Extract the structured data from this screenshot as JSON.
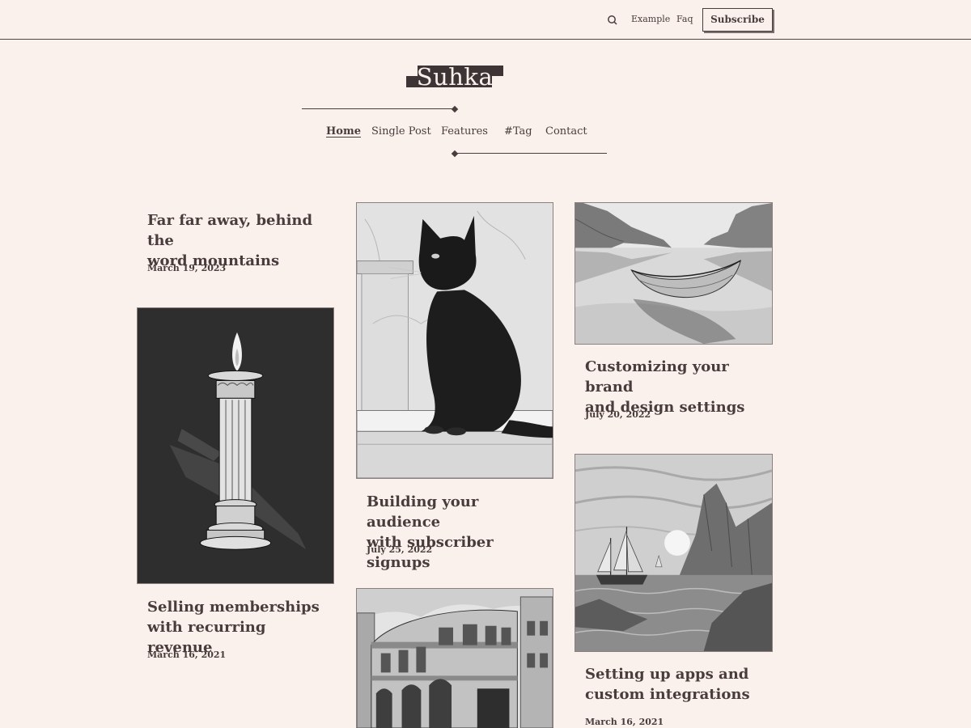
{
  "header": {
    "search_icon": "search-icon",
    "links": [
      "Example",
      "Faq"
    ],
    "subscribe_label": "Subscribe"
  },
  "site": {
    "logo_text": "Suhka"
  },
  "nav": {
    "items": [
      "Home",
      "Single Post",
      "Features",
      "#Tag",
      "Contact"
    ],
    "active": "Home"
  },
  "posts": [
    {
      "title_line1": "Far far away, behind the",
      "title_line2": "word mountains",
      "date": "March 19, 2023"
    },
    {
      "title_line1": "Selling memberships",
      "title_line2": "with recurring revenue",
      "date": "March 16, 2021"
    },
    {
      "title_line1": "Building your audience",
      "title_line2": "with subscriber signups",
      "date": "July 25, 2022"
    },
    {
      "title_line1": "Customizing your brand",
      "title_line2": "and design settings",
      "date": "July 20, 2022"
    },
    {
      "title_line1": "Setting up apps and",
      "title_line2": "custom integrations",
      "date": "March 16, 2021"
    }
  ],
  "colors": {
    "background": "#faf1ec",
    "text": "#4a3c3c",
    "accent_dark": "#3d3535"
  }
}
